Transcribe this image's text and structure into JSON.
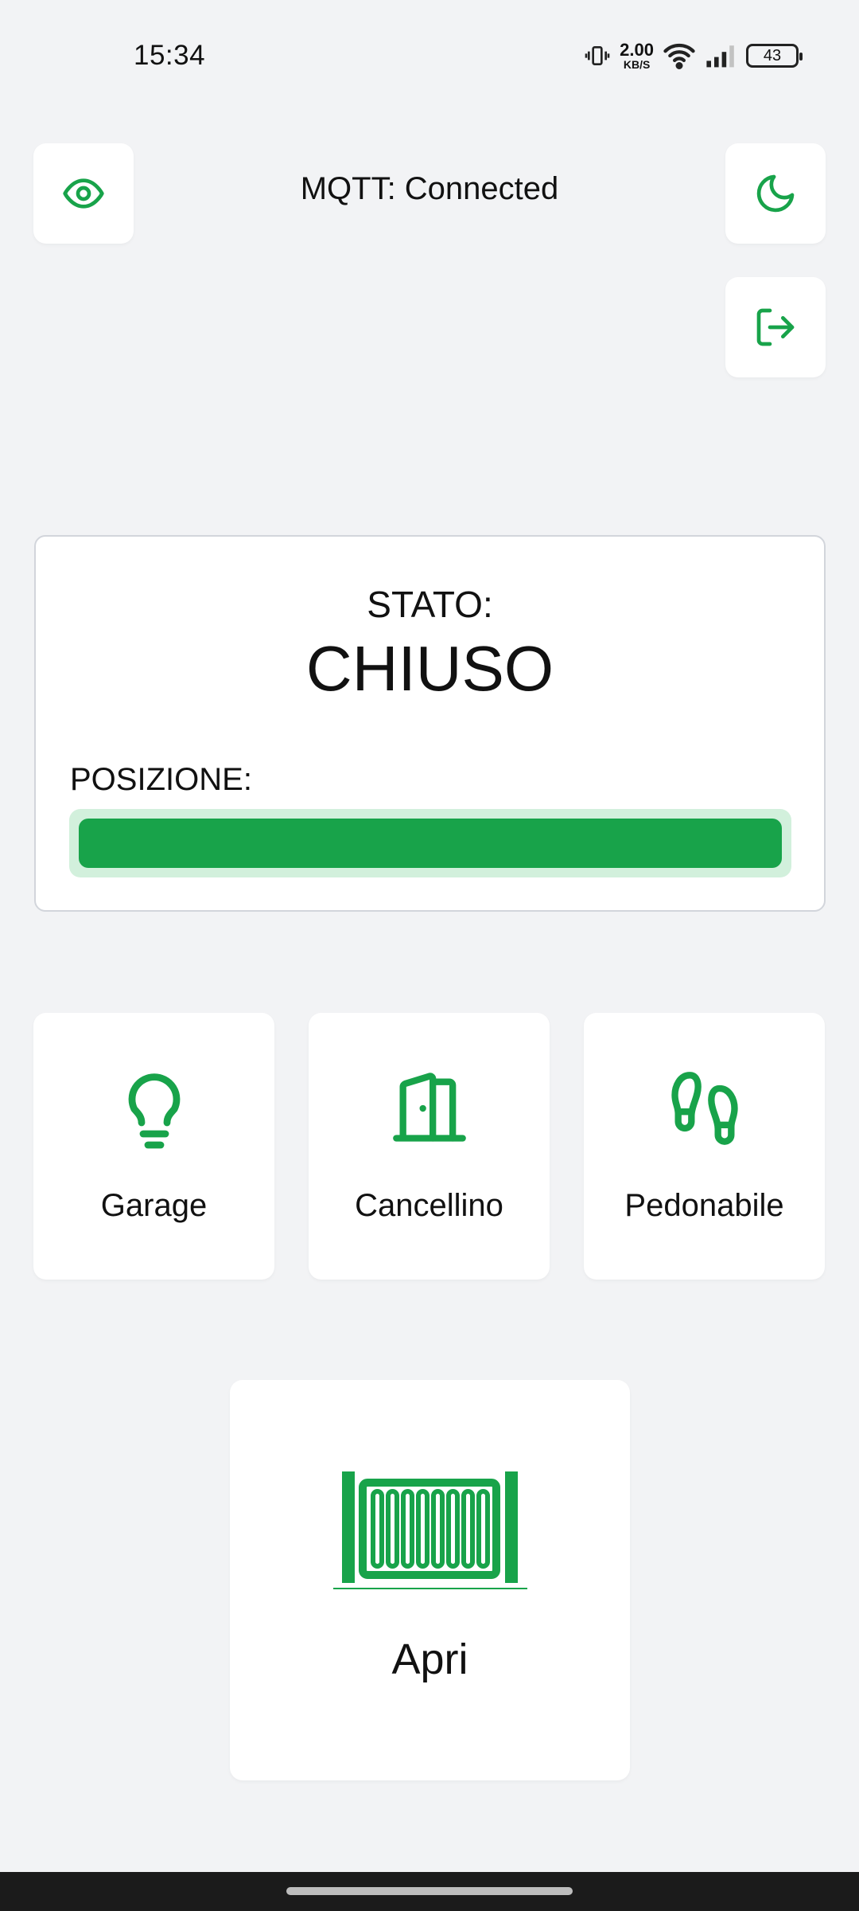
{
  "status_bar": {
    "time": "15:34",
    "net_speed_value": "2.00",
    "net_speed_unit": "KB/S",
    "battery": "43"
  },
  "header": {
    "connection_status": "MQTT: Connected"
  },
  "icons": {
    "visibility": "eye-icon",
    "theme": "moon-icon",
    "logout": "logout-icon"
  },
  "status_card": {
    "state_label": "STATO:",
    "state_value": "CHIUSO",
    "position_label": "POSIZIONE:",
    "position_fraction": 1.0
  },
  "tiles": [
    {
      "label": "Garage",
      "icon": "lightbulb-icon"
    },
    {
      "label": "Cancellino",
      "icon": "door-open-icon"
    },
    {
      "label": "Pedonabile",
      "icon": "footprints-icon"
    }
  ],
  "main_action": {
    "label": "Apri",
    "icon": "gate-icon"
  },
  "colors": {
    "accent": "#18a34a",
    "accent_light": "#d2f0dc",
    "background": "#f2f3f5"
  }
}
